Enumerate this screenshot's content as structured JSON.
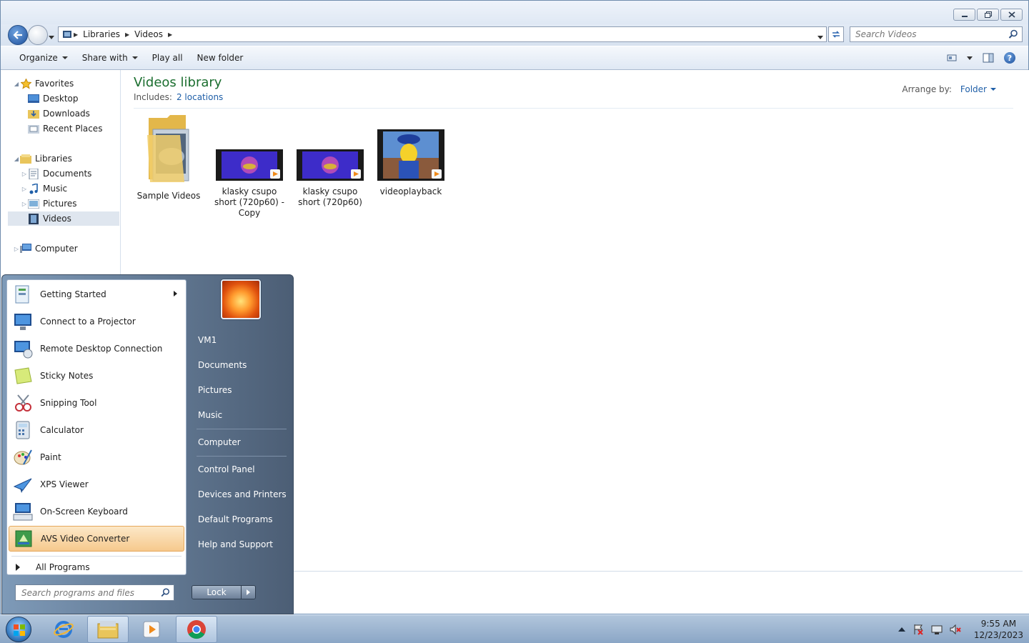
{
  "window": {
    "controls": [
      "minimize",
      "restore",
      "close"
    ]
  },
  "address": {
    "crumbs": [
      "Libraries",
      "Videos"
    ],
    "search_placeholder": "Search Videos"
  },
  "toolbar": {
    "organize": "Organize",
    "share_with": "Share with",
    "play_all": "Play all",
    "new_folder": "New folder"
  },
  "navpane": {
    "favorites": "Favorites",
    "desktop": "Desktop",
    "downloads": "Downloads",
    "recent_places": "Recent Places",
    "libraries": "Libraries",
    "documents": "Documents",
    "music": "Music",
    "pictures": "Pictures",
    "videos": "Videos",
    "computer": "Computer"
  },
  "library": {
    "title": "Videos library",
    "includes_label": "Includes:",
    "includes_link": "2 locations",
    "arrange_label": "Arrange by:",
    "arrange_value": "Folder"
  },
  "files": [
    {
      "line1": "Sample Videos",
      "line2": "",
      "line3": ""
    },
    {
      "line1": "klasky csupo",
      "line2": "short (720p60) -",
      "line3": "Copy"
    },
    {
      "line1": "klasky csupo",
      "line2": "short (720p60)",
      "line3": ""
    },
    {
      "line1": "videoplayback",
      "line2": "",
      "line3": ""
    }
  ],
  "startmenu": {
    "programs": [
      {
        "label": "Getting Started",
        "icon": "getting-started-icon"
      },
      {
        "label": "Connect to a Projector",
        "icon": "projector-icon"
      },
      {
        "label": "Remote Desktop Connection",
        "icon": "remote-desktop-icon"
      },
      {
        "label": "Sticky Notes",
        "icon": "sticky-notes-icon"
      },
      {
        "label": "Snipping Tool",
        "icon": "snipping-tool-icon"
      },
      {
        "label": "Calculator",
        "icon": "calculator-icon"
      },
      {
        "label": "Paint",
        "icon": "paint-icon"
      },
      {
        "label": "XPS Viewer",
        "icon": "xps-viewer-icon"
      },
      {
        "label": "On-Screen Keyboard",
        "icon": "keyboard-icon"
      },
      {
        "label": "AVS Video Converter",
        "icon": "avs-icon"
      }
    ],
    "all_programs": "All Programs",
    "search_placeholder": "Search programs and files",
    "right": {
      "user": "VM1",
      "documents": "Documents",
      "pictures": "Pictures",
      "music": "Music",
      "computer": "Computer",
      "control_panel": "Control Panel",
      "devices": "Devices and Printers",
      "default_programs": "Default Programs",
      "help": "Help and Support"
    },
    "lock": "Lock"
  },
  "taskbar": {
    "apps": [
      "internet-explorer-icon",
      "windows-explorer-icon",
      "media-player-icon",
      "chrome-icon"
    ],
    "time": "9:55 AM",
    "date": "12/23/2023"
  },
  "colors": {
    "accent_link": "#1f5fa8",
    "library_title": "#1b6e2f",
    "highlight": "#f6c98d"
  }
}
